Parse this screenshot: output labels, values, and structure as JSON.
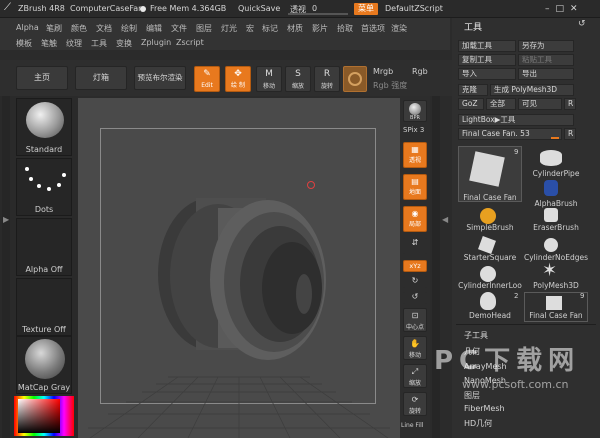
{
  "titlebar": {
    "app": "ZBrush 4R8",
    "doc": "ComputerCaseFan",
    "free_mem": "Free Mem 4.364GB",
    "quicksave": "QuickSave",
    "transparency": "透视",
    "transparency_val": "0",
    "menu_btn": "菜单",
    "script": "DefaultZScript"
  },
  "menu_row1": [
    "Alpha",
    "笔刷",
    "颜色",
    "文档",
    "绘制",
    "编辑",
    "文件",
    "图层",
    "灯光",
    "宏",
    "标记",
    "材质",
    "影片",
    "拾取",
    "首选项",
    "渲染"
  ],
  "menu_row2": [
    "模板",
    "笔触",
    "纹理",
    "工具",
    "变换",
    "Zplugin",
    "Zscript"
  ],
  "shelf": {
    "home": "主页",
    "lightbox": "灯箱",
    "bpr": "预览布尔渲染",
    "edit": "Edit",
    "draw": "绘 制",
    "move": "移动",
    "scale": "缩放",
    "rotate": "旋转",
    "mrgb": "Mrgb",
    "rgb": "Rgb",
    "rgb_intensity": "Rgb 强度"
  },
  "left": {
    "standard": "Standard",
    "dots": "Dots",
    "alpha_off": "Alpha Off",
    "texture_off": "Texture Off",
    "matcap": "MatCap Gray"
  },
  "strip": {
    "bpr": "BPR",
    "spix": "SPix",
    "spix_val": "3",
    "persp": "透视",
    "floor": "地面",
    "local": "局部",
    "xyz": "xYz",
    "center": "中心点",
    "move": "移动",
    "scale": "缩放",
    "rotate": "旋转",
    "linefill": "Line Fill"
  },
  "panel": {
    "title": "工具",
    "load": "加载工具",
    "saveas": "另存为",
    "copy": "复制工具",
    "paste": "粘贴工具",
    "import": "导入",
    "export": "导出",
    "clone": "克隆",
    "make_poly": "生成 PolyMesh3D",
    "goz": "GoZ",
    "all": "全部",
    "visible": "可见",
    "r": "R",
    "lightbox_tools": "LightBox▶工具",
    "current": "Final Case Fan.",
    "current_val": "53",
    "tools": [
      "Final Case Fan",
      "CylinderPipe",
      "",
      "AlphaBrush",
      "SimpleBrush",
      "EraserBrush",
      "StarterSquare",
      "CylinderNoEdges",
      "CylinderInnerLoo",
      "PolyMesh3D",
      "DemoHead",
      "Final Case Fan"
    ],
    "tool_count_1": "9",
    "tool_count_2": "2",
    "tool_count_3": "9",
    "subtools": [
      "子工具",
      "几何",
      "ArrayMesh",
      "NanoMesh",
      "图层",
      "FiberMesh",
      "HD几何"
    ]
  },
  "watermark": {
    "line1": "PC下载网",
    "line2": "www.pcsoft.com.cn"
  }
}
